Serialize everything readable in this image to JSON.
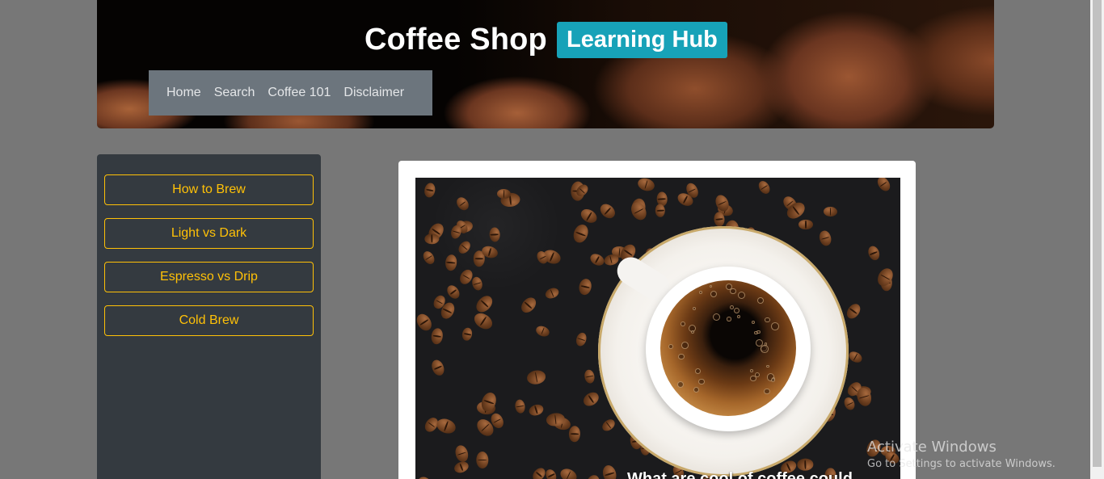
{
  "header": {
    "brand_title": "Coffee Shop",
    "brand_badge": "Learning Hub",
    "nav": [
      {
        "label": "Home"
      },
      {
        "label": "Search"
      },
      {
        "label": "Coffee 101"
      },
      {
        "label": "Disclaimer"
      }
    ]
  },
  "sidebar": {
    "buttons": [
      {
        "label": "How to Brew"
      },
      {
        "label": "Light vs Dark"
      },
      {
        "label": "Espresso vs Drip"
      },
      {
        "label": "Cold Brew"
      }
    ]
  },
  "main": {
    "hero_image": "coffee-cup-and-beans-image",
    "hero_caption": "What are cool of coffee could"
  },
  "watermark": {
    "title": "Activate Windows",
    "subtitle": "Go to Settings to activate Windows."
  },
  "colors": {
    "page_bg": "#777777",
    "nav_bg": "#6c757d",
    "sidebar_bg": "#343a40",
    "accent_warning": "#ffc107",
    "badge_info": "#17a2b8"
  }
}
